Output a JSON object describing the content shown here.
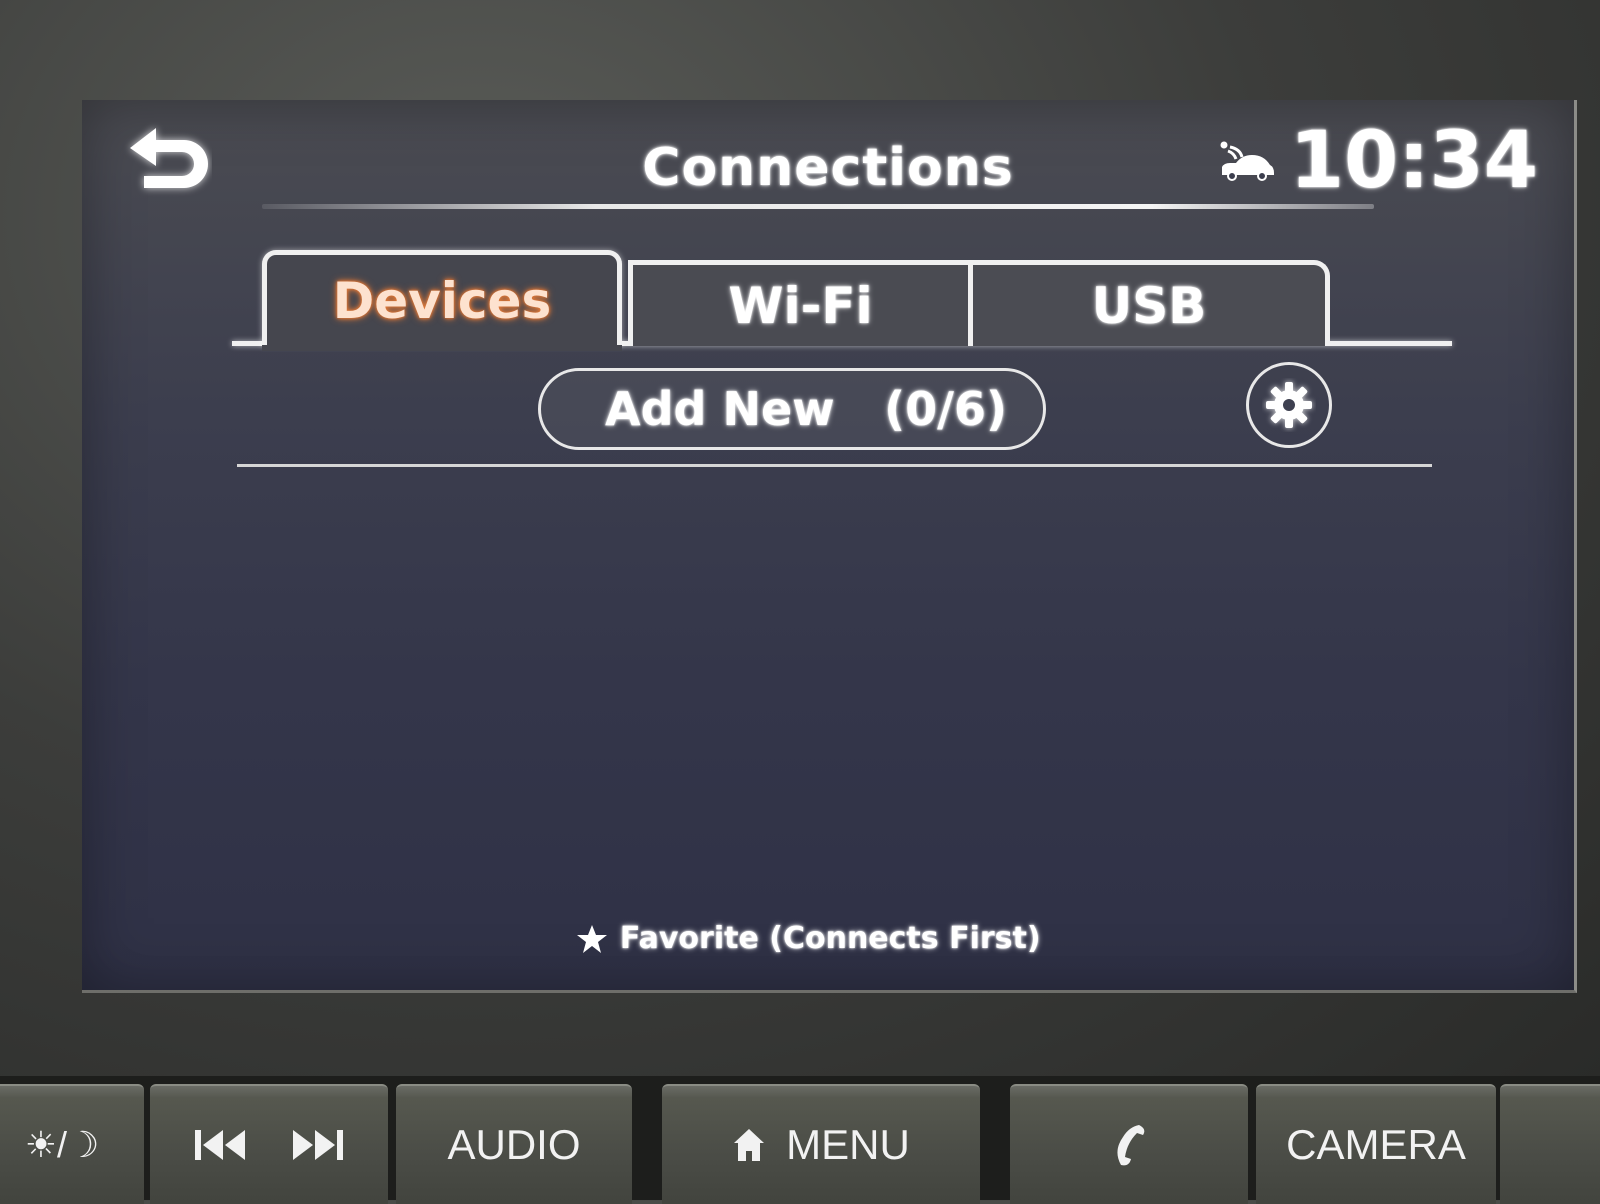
{
  "header": {
    "title": "Connections",
    "clock": "10:34",
    "back_icon": "back-arrow-icon",
    "status_icon": "connected-car-icon"
  },
  "tabs": [
    {
      "label": "Devices",
      "active": true
    },
    {
      "label": "Wi-Fi",
      "active": false
    },
    {
      "label": "USB",
      "active": false
    }
  ],
  "toolbar": {
    "add_new_label": "Add New",
    "device_count": "(0/6)",
    "settings_icon": "gear-icon"
  },
  "device_list": [],
  "footer": {
    "favorite_icon": "star-icon",
    "favorite_note": "Favorite (Connects First)"
  },
  "hard_keys": [
    {
      "name": "day-night",
      "label": "☀/☽"
    },
    {
      "name": "track",
      "label": ""
    },
    {
      "name": "audio",
      "label": "AUDIO"
    },
    {
      "name": "menu",
      "label": "MENU"
    },
    {
      "name": "phone",
      "label": ""
    },
    {
      "name": "camera",
      "label": "CAMERA"
    }
  ],
  "colors": {
    "active_tab_text": "#e07a3a",
    "screen_bg": "#34364a",
    "text": "#ffffff"
  }
}
